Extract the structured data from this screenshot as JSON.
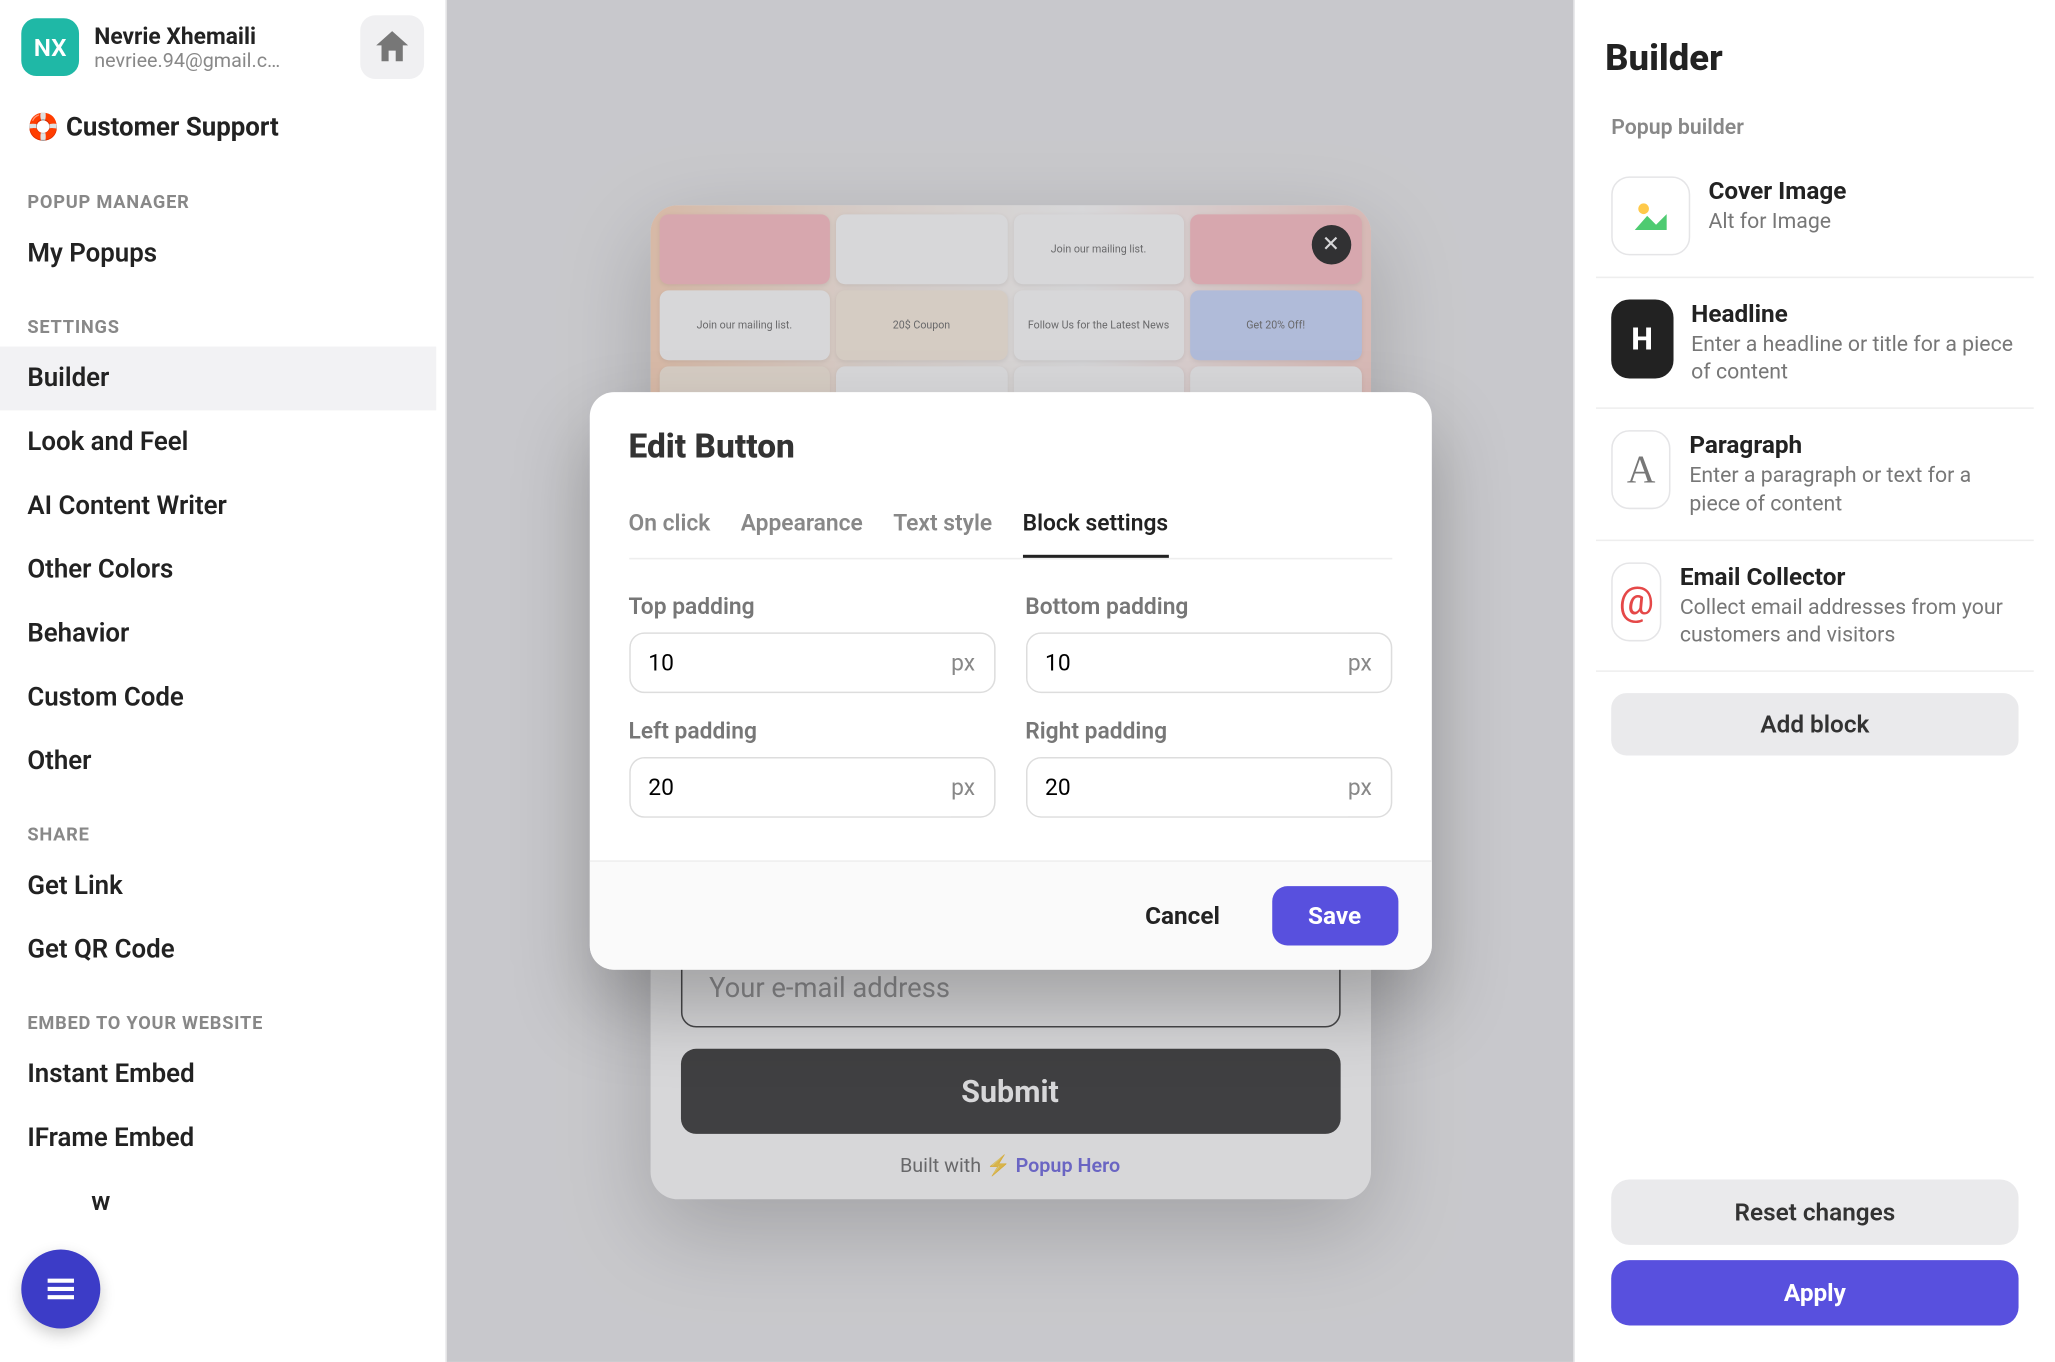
{
  "user": {
    "initials": "NX",
    "name": "Nevrie Xhemaili",
    "email": "nevriee.94@gmail.c…"
  },
  "sidebar": {
    "support": "🛟 Customer Support",
    "groups": {
      "popup_manager": "POPUP MANAGER",
      "settings": "SETTINGS",
      "share": "SHARE",
      "embed": "EMBED TO YOUR WEBSITE"
    },
    "items": {
      "my_popups": "My Popups",
      "builder": "Builder",
      "look_feel": "Look and Feel",
      "ai_writer": "AI Content Writer",
      "other_colors": "Other Colors",
      "behavior": "Behavior",
      "custom_code": "Custom Code",
      "other": "Other",
      "get_link": "Get Link",
      "get_qr": "Get QR Code",
      "instant_embed": "Instant Embed",
      "iframe_embed": "IFrame Embed",
      "w_cut": "w"
    }
  },
  "right": {
    "title": "Builder",
    "subhead": "Popup builder",
    "blocks": {
      "cover": {
        "title": "Cover Image",
        "sub": "Alt for Image"
      },
      "headline": {
        "title": "Headline",
        "sub": "Enter a headline or title for a piece of content"
      },
      "paragraph": {
        "title": "Paragraph",
        "sub": "Enter a paragraph or text for a piece of content"
      },
      "email": {
        "title": "Email Collector",
        "sub": "Collect email addresses from your customers and visitors"
      }
    },
    "add_block": "Add block",
    "reset": "Reset changes",
    "apply": "Apply"
  },
  "preview": {
    "email_placeholder": "Your e-mail address",
    "submit": "Submit",
    "built_with": "Built with ",
    "zap": "⚡",
    "brand": "Popup Hero"
  },
  "modal": {
    "title": "Edit Button",
    "tabs": {
      "onclick": "On click",
      "appearance": "Appearance",
      "text": "Text style",
      "block": "Block settings"
    },
    "fields": {
      "top": {
        "label": "Top padding",
        "value": "10",
        "unit": "px"
      },
      "bottom": {
        "label": "Bottom padding",
        "value": "10",
        "unit": "px"
      },
      "left": {
        "label": "Left padding",
        "value": "20",
        "unit": "px"
      },
      "right": {
        "label": "Right padding",
        "value": "20",
        "unit": "px"
      }
    },
    "cancel": "Cancel",
    "save": "Save"
  }
}
